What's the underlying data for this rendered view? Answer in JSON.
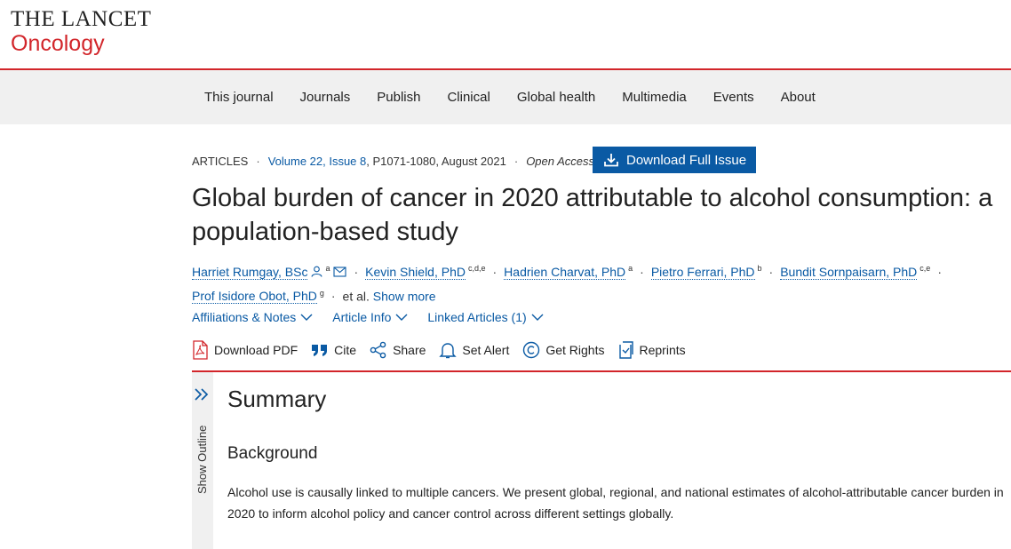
{
  "logo": {
    "line1": "THE LANCET",
    "line2": "Oncology"
  },
  "nav": {
    "items": [
      "This journal",
      "Journals",
      "Publish",
      "Clinical",
      "Global health",
      "Multimedia",
      "Events",
      "About"
    ]
  },
  "meta": {
    "type": "ARTICLES",
    "volume": "Volume 22, Issue 8",
    "pages": ", P1071-1080, August 2021",
    "access": "Open Access",
    "download_issue": "Download Full Issue"
  },
  "article": {
    "title": "Global burden of cancer in 2020 attributable to alcohol consumption: a population-based study"
  },
  "authors": [
    {
      "name": "Harriet Rumgay, BSc",
      "sup": "a"
    },
    {
      "name": "Kevin Shield, PhD",
      "sup": "c,d,e"
    },
    {
      "name": "Hadrien Charvat, PhD",
      "sup": "a"
    },
    {
      "name": "Pietro Ferrari, PhD",
      "sup": "b"
    },
    {
      "name": "Bundit Sornpaisarn, PhD",
      "sup": "c,e"
    },
    {
      "name": "Prof Isidore Obot, PhD",
      "sup": "g"
    }
  ],
  "authors_extra": {
    "et_al": "et al.",
    "show_more": "Show more"
  },
  "tabs": [
    "Affiliations & Notes",
    "Article Info",
    "Linked Articles (1)"
  ],
  "tools": [
    "Download PDF",
    "Cite",
    "Share",
    "Set Alert",
    "Get Rights",
    "Reprints"
  ],
  "outline": {
    "label": "Show Outline"
  },
  "summary": {
    "heading": "Summary",
    "subheading": "Background",
    "text": "Alcohol use is causally linked to multiple cancers. We present global, regional, and national estimates of alcohol-attributable cancer burden in 2020 to inform alcohol policy and cancer control across different settings globally."
  },
  "colors": {
    "accent_red": "#d2252a",
    "link_blue": "#0a5aa4",
    "nav_bg": "#f0f0f0"
  }
}
